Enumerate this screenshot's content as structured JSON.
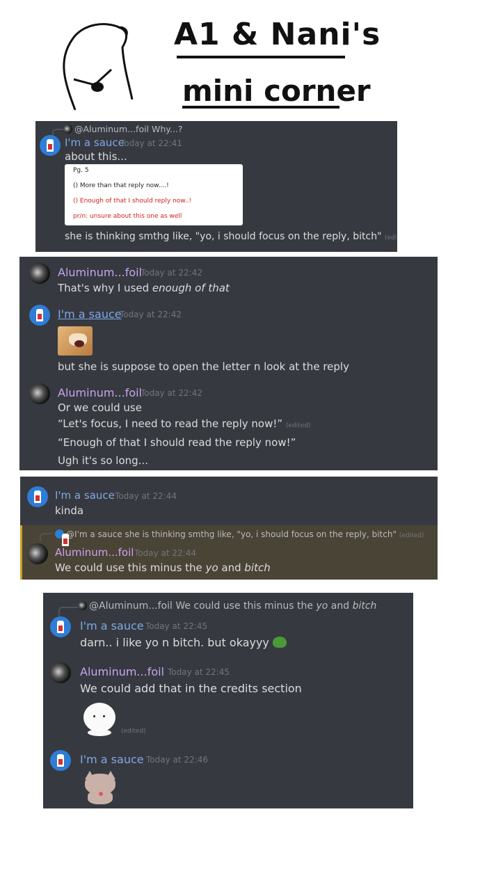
{
  "header": {
    "title_line1": "A1 & Nani's",
    "title_line2": "mini corner"
  },
  "users": {
    "sauce": "I'm a sauce",
    "foil": "Aluminum...foil"
  },
  "panel1": {
    "reply_user": "@Aluminum...foil",
    "reply_text": "Why...?",
    "time": "Today at 22:41",
    "line1": "about this...",
    "doc": {
      "page": "Pg. 5",
      "item1": "() More than that reply now....!",
      "item2": "() Enough of that I should reply now..!",
      "item3": "pr/n: unsure about this one as well"
    },
    "line2": "she is thinking smthg like, \"yo, i should focus on the reply, bitch\"",
    "edited": "(edited)"
  },
  "panel2": {
    "m1_time": "Today at 22:42",
    "m1_text_a": "That's why I used ",
    "m1_text_b": "enough of that",
    "m2_time": "Today at 22:42",
    "m2_text": "but she is suppose to open the letter n look at the reply",
    "m3_time": "Today at 22:42",
    "m3_l1": "Or we could use",
    "m3_l2": "“Let's focus, I need to read the reply now!”",
    "m3_edited": "(edited)",
    "m3_l3": "“Enough of that I should read the reply now!”",
    "m3_l4": "Ugh it's so long..."
  },
  "panel3": {
    "m1_time": "Today at 22:44",
    "m1_text": "kinda",
    "reply_user": "@I'm a sauce",
    "reply_text": "she is thinking smthg like, \"yo, i should focus on the reply, bitch\"",
    "reply_edited": "(edited)",
    "m2_time": "Today at 22:44",
    "m2_a": "We could use this minus the ",
    "m2_b": "yo",
    "m2_c": " and ",
    "m2_d": "bitch"
  },
  "panel4": {
    "reply_user": "@Aluminum...foil",
    "reply_a": "We could use this minus the ",
    "reply_b": "yo",
    "reply_c": " and ",
    "reply_d": "bitch",
    "m1_time": "Today at 22:45",
    "m1_text": "darn.. i like yo n bitch. but okayyy",
    "m2_time": "Today at 22:45",
    "m2_text": "We could add that in the credits section",
    "m2_edited": "(edited)",
    "m3_time": "Today at 22:46"
  },
  "colors": {
    "panel_bg": "#36393f",
    "sauce_name": "#7fa8e8",
    "foil_name": "#c9a4f0",
    "highlight_bg": "#4a4436"
  }
}
